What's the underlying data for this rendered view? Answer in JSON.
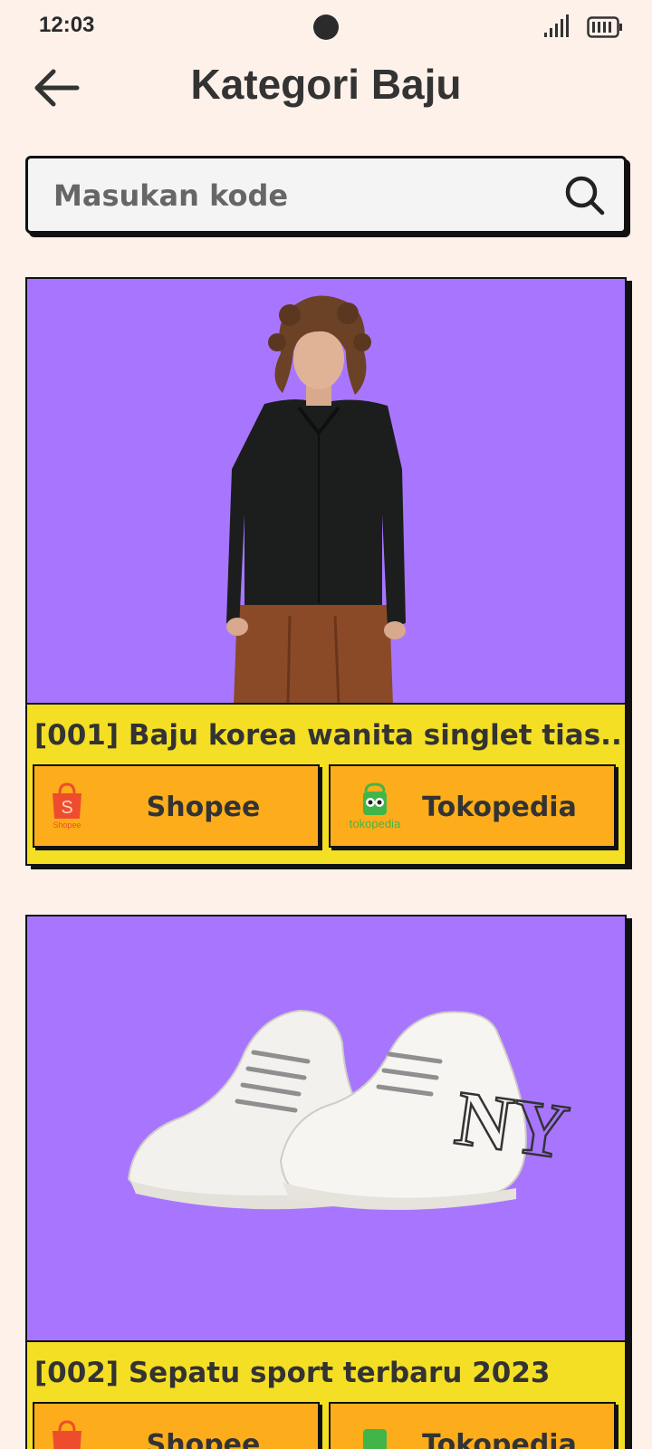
{
  "status": {
    "time": "12:03"
  },
  "header": {
    "title": "Kategori Baju"
  },
  "search": {
    "placeholder": "Masukan kode"
  },
  "stores": {
    "shopee_label": "Shopee",
    "shopee_logo_text": "Shopee",
    "tokopedia_label": "Tokopedia",
    "tokopedia_logo_text": "tokopedia"
  },
  "products": [
    {
      "title": "[001] Baju korea wanita singlet tias..."
    },
    {
      "title": "[002] Sepatu sport terbaru 2023"
    }
  ],
  "colors": {
    "background": "#fdf1ea",
    "card_image_bg": "#a876fe",
    "card_body_bg": "#f5df24",
    "button_bg": "#fdad1b"
  },
  "icons": [
    "back-arrow-icon",
    "search-icon",
    "signal-icon",
    "battery-icon",
    "shopee-logo",
    "tokopedia-logo"
  ]
}
